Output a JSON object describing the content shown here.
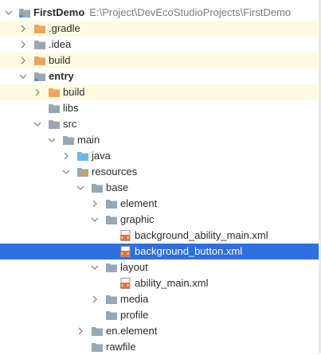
{
  "project": {
    "name": "FirstDemo",
    "path": "E:\\Project\\DevEcoStudioProjects\\FirstDemo"
  },
  "tree": {
    "gradle": ".gradle",
    "idea": ".idea",
    "build_root": "build",
    "entry": "entry",
    "entry_build": "build",
    "libs": "libs",
    "src": "src",
    "main": "main",
    "java": "java",
    "resources": "resources",
    "base": "base",
    "element": "element",
    "graphic": "graphic",
    "bg_ability_main": "background_ability_main.xml",
    "bg_button": "background_button.xml",
    "layout": "layout",
    "ability_main": "ability_main.xml",
    "media": "media",
    "profile": "profile",
    "en_element": "en.element",
    "rawfile": "rawfile"
  },
  "colors": {
    "selection": "#2f6fe0",
    "highlight_row": "#fefbe3",
    "folder": "#9aa7b0",
    "excluded_folder": "#f0a35e",
    "source_folder": "#6fb5e3"
  }
}
